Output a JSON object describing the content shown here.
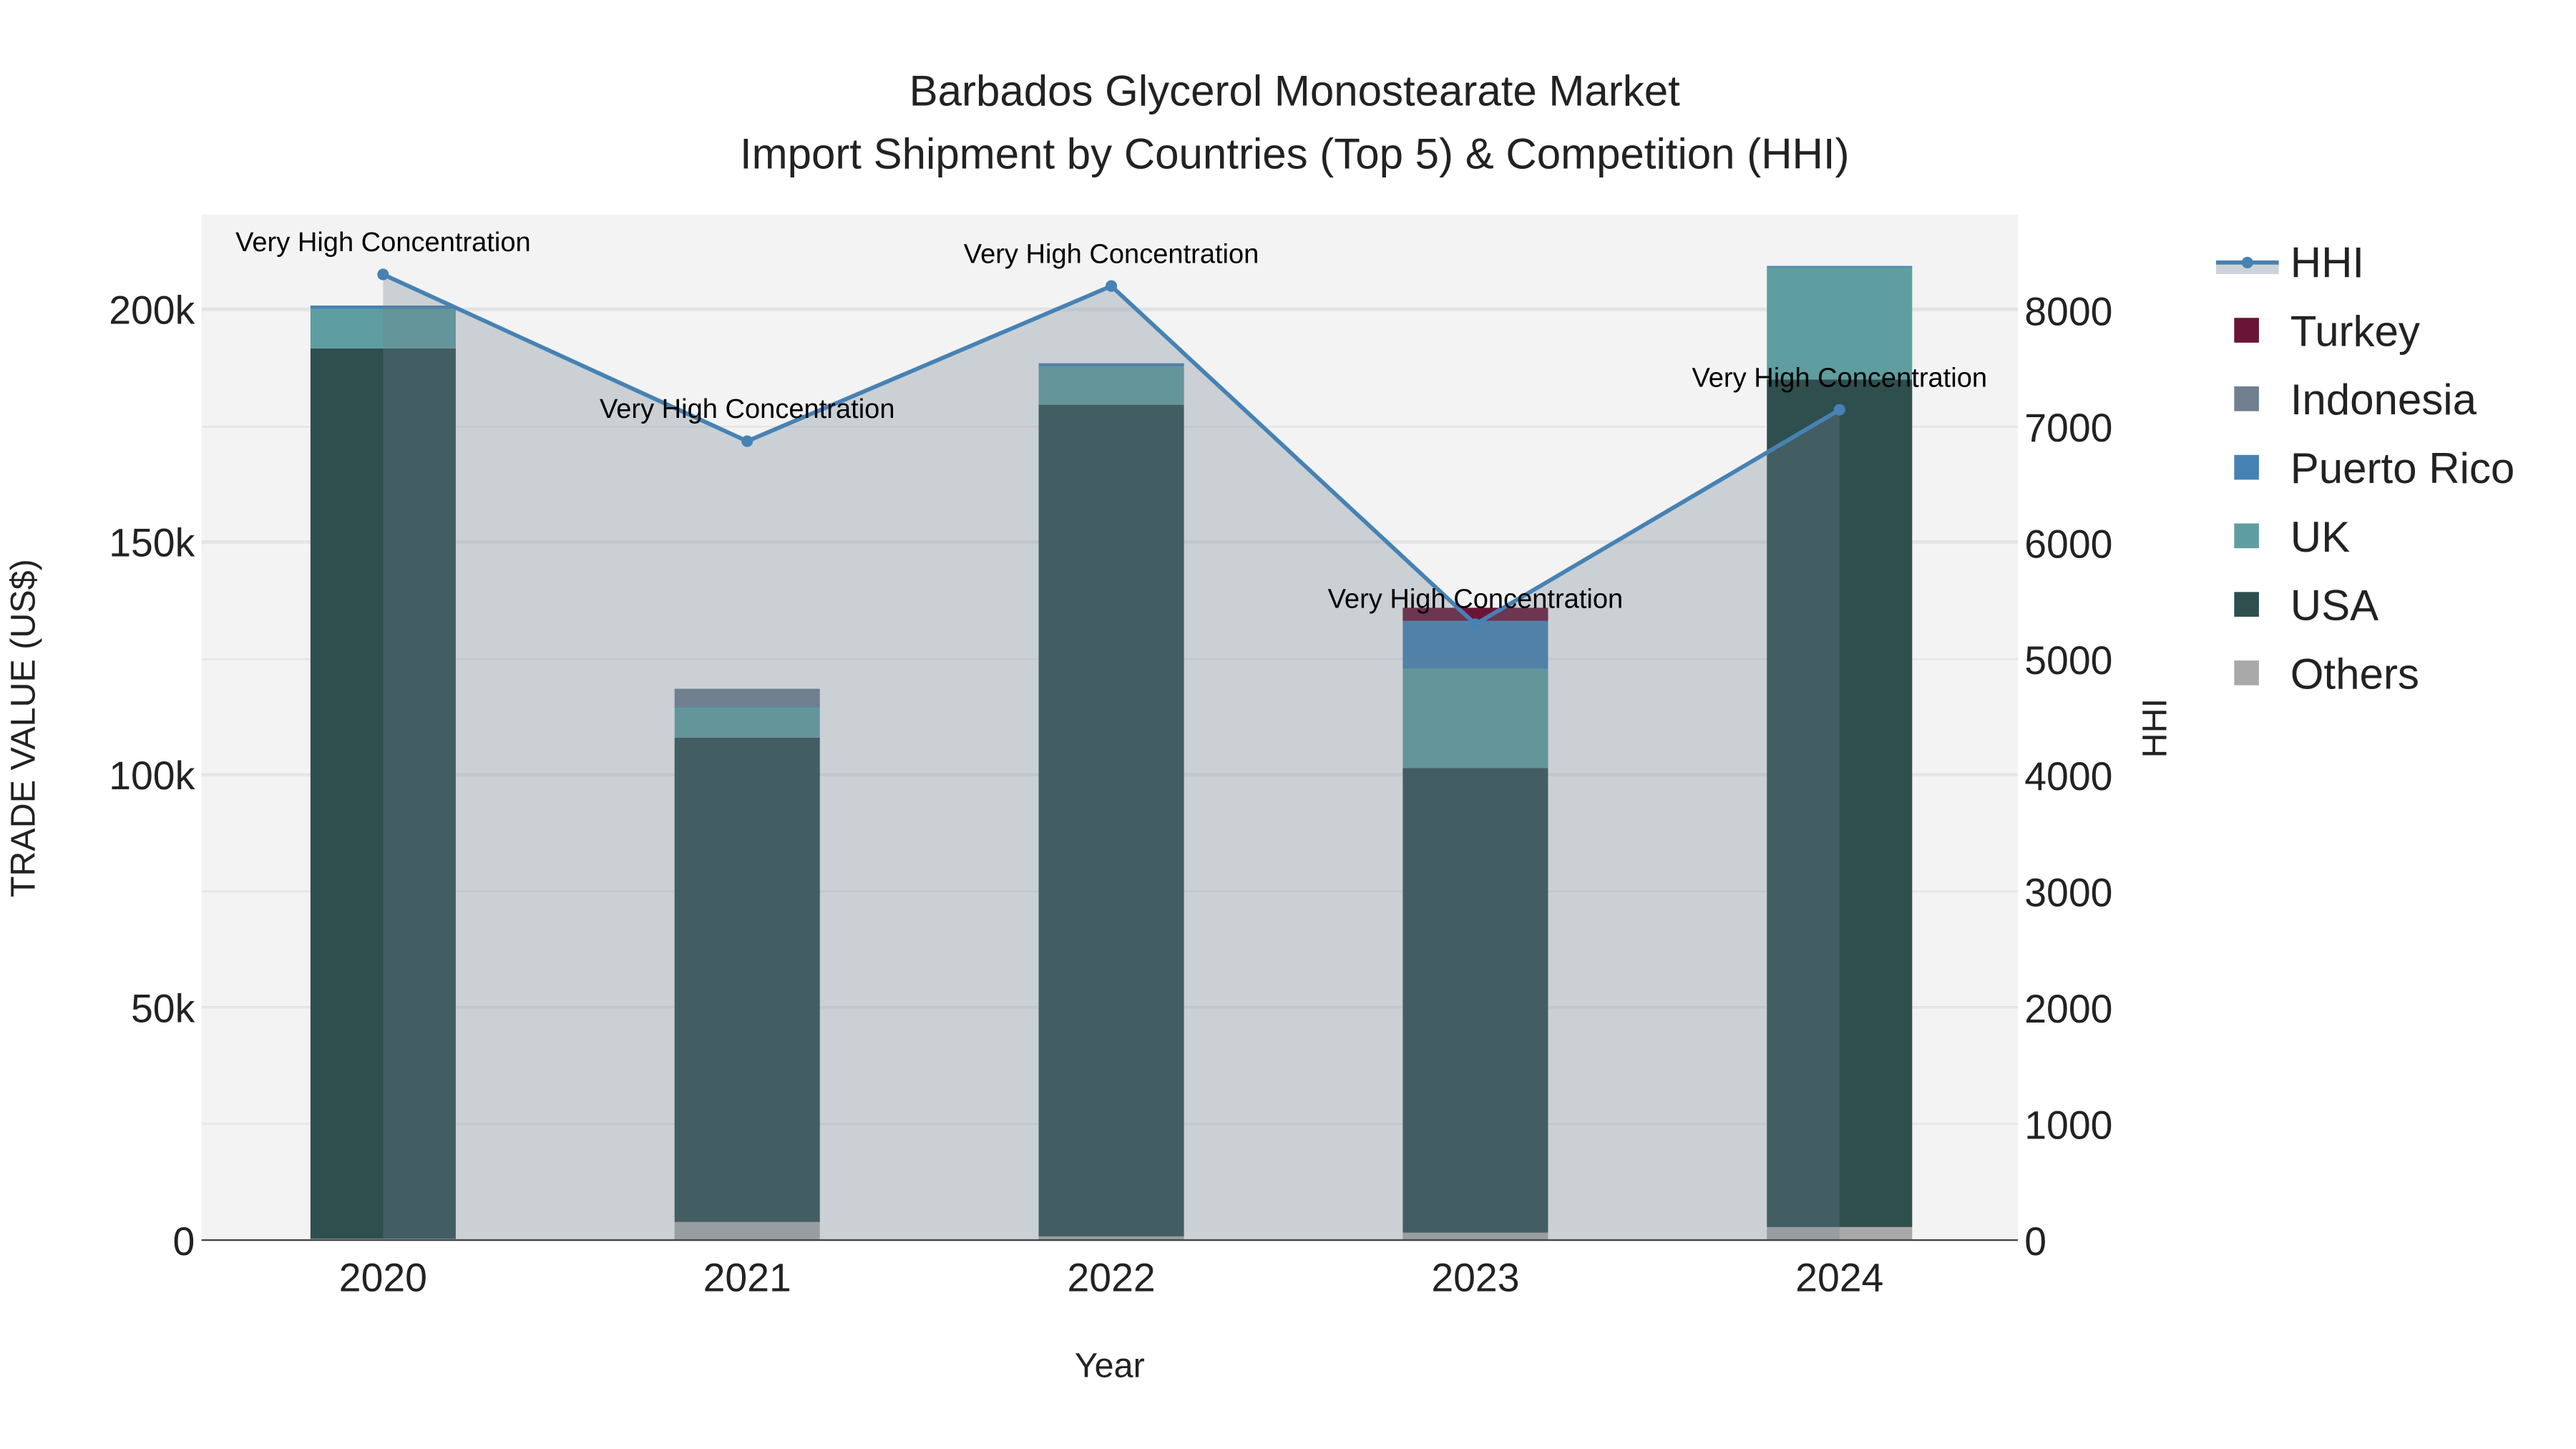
{
  "chart_data": {
    "type": "bar",
    "title_line1": "Barbados Glycerol Monostearate Market",
    "title_line2": "Import Shipment by Countries (Top 5) & Competition (HHI)",
    "xlabel": "Year",
    "ylabel": "TRADE VALUE (US$)",
    "y2label": "HHI",
    "categories": [
      "2020",
      "2021",
      "2022",
      "2023",
      "2024"
    ],
    "ylim": [
      0,
      220000
    ],
    "y2lim": [
      0,
      8800
    ],
    "yticks": [
      0,
      50000,
      100000,
      150000,
      200000
    ],
    "ytick_labels": [
      "0",
      "50k",
      "100k",
      "150k",
      "200k"
    ],
    "y2ticks": [
      0,
      1000,
      2000,
      3000,
      4000,
      5000,
      6000,
      7000,
      8000
    ],
    "y2tick_labels": [
      "0",
      "1000",
      "2000",
      "3000",
      "4000",
      "5000",
      "6000",
      "7000",
      "8000"
    ],
    "series": [
      {
        "name": "Others",
        "color": "#a9a9a9",
        "values": [
          300,
          3900,
          800,
          1600,
          2800
        ]
      },
      {
        "name": "USA",
        "color": "#2f4f4f",
        "values": [
          191200,
          104000,
          178600,
          99800,
          182000
        ]
      },
      {
        "name": "UK",
        "color": "#5f9ea0",
        "values": [
          8500,
          6400,
          8200,
          21300,
          24100
        ]
      },
      {
        "name": "Puerto Rico",
        "color": "#4682b4",
        "values": [
          700,
          300,
          700,
          10300,
          300
        ]
      },
      {
        "name": "Indonesia",
        "color": "#708090",
        "values": [
          0,
          3800,
          0,
          0,
          0
        ]
      },
      {
        "name": "Turkey",
        "color": "#6b1536",
        "values": [
          0,
          0,
          0,
          2800,
          0
        ]
      }
    ],
    "hhi": {
      "name": "HHI",
      "color": "#4682b4",
      "values": [
        8310,
        6875,
        8210,
        5300,
        7145
      ],
      "annotations": [
        "Very High Concentration",
        "Very High Concentration",
        "Very High Concentration",
        "Very High Concentration",
        "Very High Concentration"
      ]
    },
    "legend_order": [
      "HHI",
      "Turkey",
      "Indonesia",
      "Puerto Rico",
      "UK",
      "USA",
      "Others"
    ],
    "legend_position": "right",
    "grid": true
  }
}
